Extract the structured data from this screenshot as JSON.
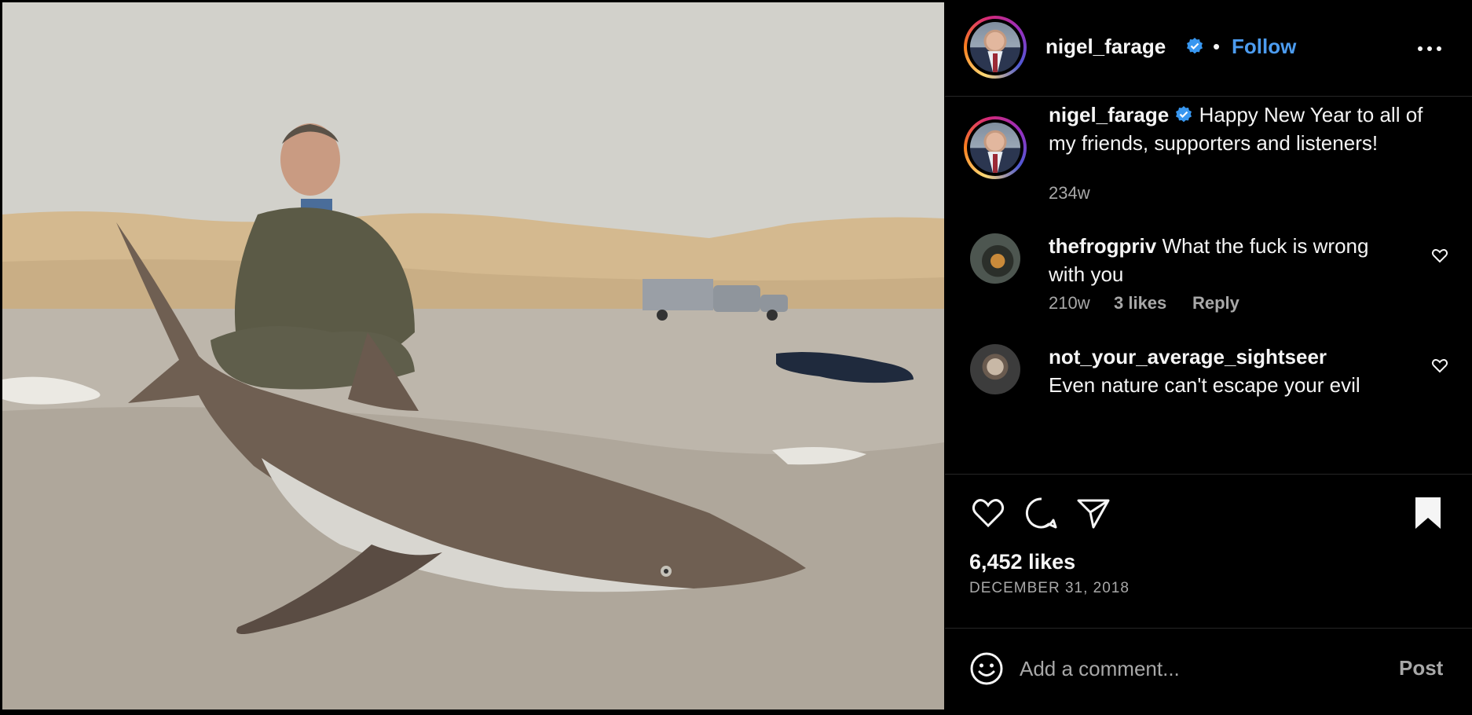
{
  "post": {
    "username": "nigel_farage",
    "follow_label": "Follow",
    "separator": "•",
    "caption": "Happy New Year to all of my friends, supporters and listeners!",
    "caption_age": "234w",
    "likes": "6,452 likes",
    "date": "DECEMBER 31, 2018"
  },
  "comments": [
    {
      "username": "thefrogpriv",
      "text": "What the fuck is wrong with you",
      "age": "210w",
      "likes": "3 likes",
      "reply_label": "Reply"
    },
    {
      "username": "not_your_average_sightseer",
      "text": "Even nature can't escape your evil"
    }
  ],
  "comment_box": {
    "placeholder": "Add a comment...",
    "post_label": "Post"
  },
  "icons": {
    "verified": "verified-badge-icon",
    "more": "more-options-icon",
    "like": "heart-icon",
    "comment": "comment-icon",
    "share": "share-icon",
    "save": "bookmark-icon",
    "emoji": "emoji-icon"
  },
  "colors": {
    "background": "#000000",
    "link_blue": "#4c9cf0",
    "verified_blue": "#3897f0",
    "muted_text": "#a8a8a8",
    "divider": "#262626"
  }
}
